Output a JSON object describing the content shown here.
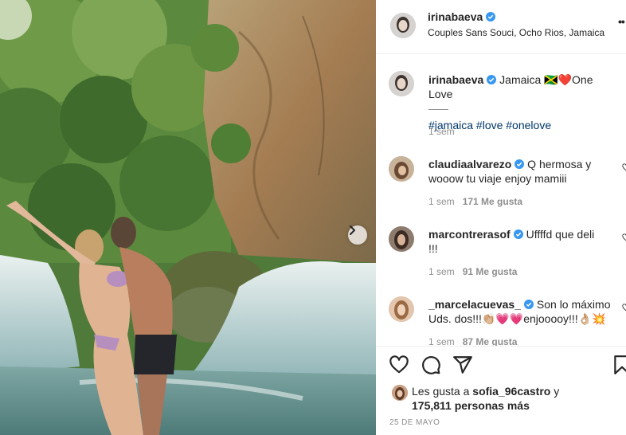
{
  "post": {
    "author": "irinabaeva",
    "location": "Couples Sans Souci, Ocho Rios, Jamaica",
    "caption_text": "Jamaica 🇯🇲❤️One Love",
    "hashtags": "#jamaica #love #onelove",
    "caption_time": "1 sem",
    "date": "25 DE MAYO"
  },
  "comments": [
    {
      "user": "claudiaalvarezo",
      "text_line1": "Q hermosa y",
      "text_line2": "wooow tu viaje enjoy mamiii",
      "time": "1 sem",
      "likes": "171 Me gusta"
    },
    {
      "user": "marcontrerasof",
      "text_line1": "Uffffd que deli",
      "text_line2": "!!!",
      "time": "1 sem",
      "likes": "91 Me gusta"
    },
    {
      "user": "_marcelacuevas_",
      "text_line1": "Son lo máximo",
      "text_line2": "Uds. dos!!!👏🏼💗💗enjooooy!!!👌🏼💥",
      "time": "1 sem",
      "likes": "87 Me gusta"
    }
  ],
  "likes": {
    "prefix": "Les gusta a ",
    "first_user": "sofia_96castro",
    "joiner": " y",
    "others": "175,811 personas más"
  },
  "icons": {
    "verified": "verified-badge-icon",
    "more": "more-options-icon",
    "heart": "heart-icon",
    "comment": "comment-icon",
    "share": "share-icon",
    "save": "bookmark-icon",
    "next": "chevron-right-icon"
  },
  "colors": {
    "verified_blue": "#3897f0",
    "link_blue": "#00376b",
    "muted_gray": "#8e8e8e",
    "text_dark": "#262626"
  }
}
